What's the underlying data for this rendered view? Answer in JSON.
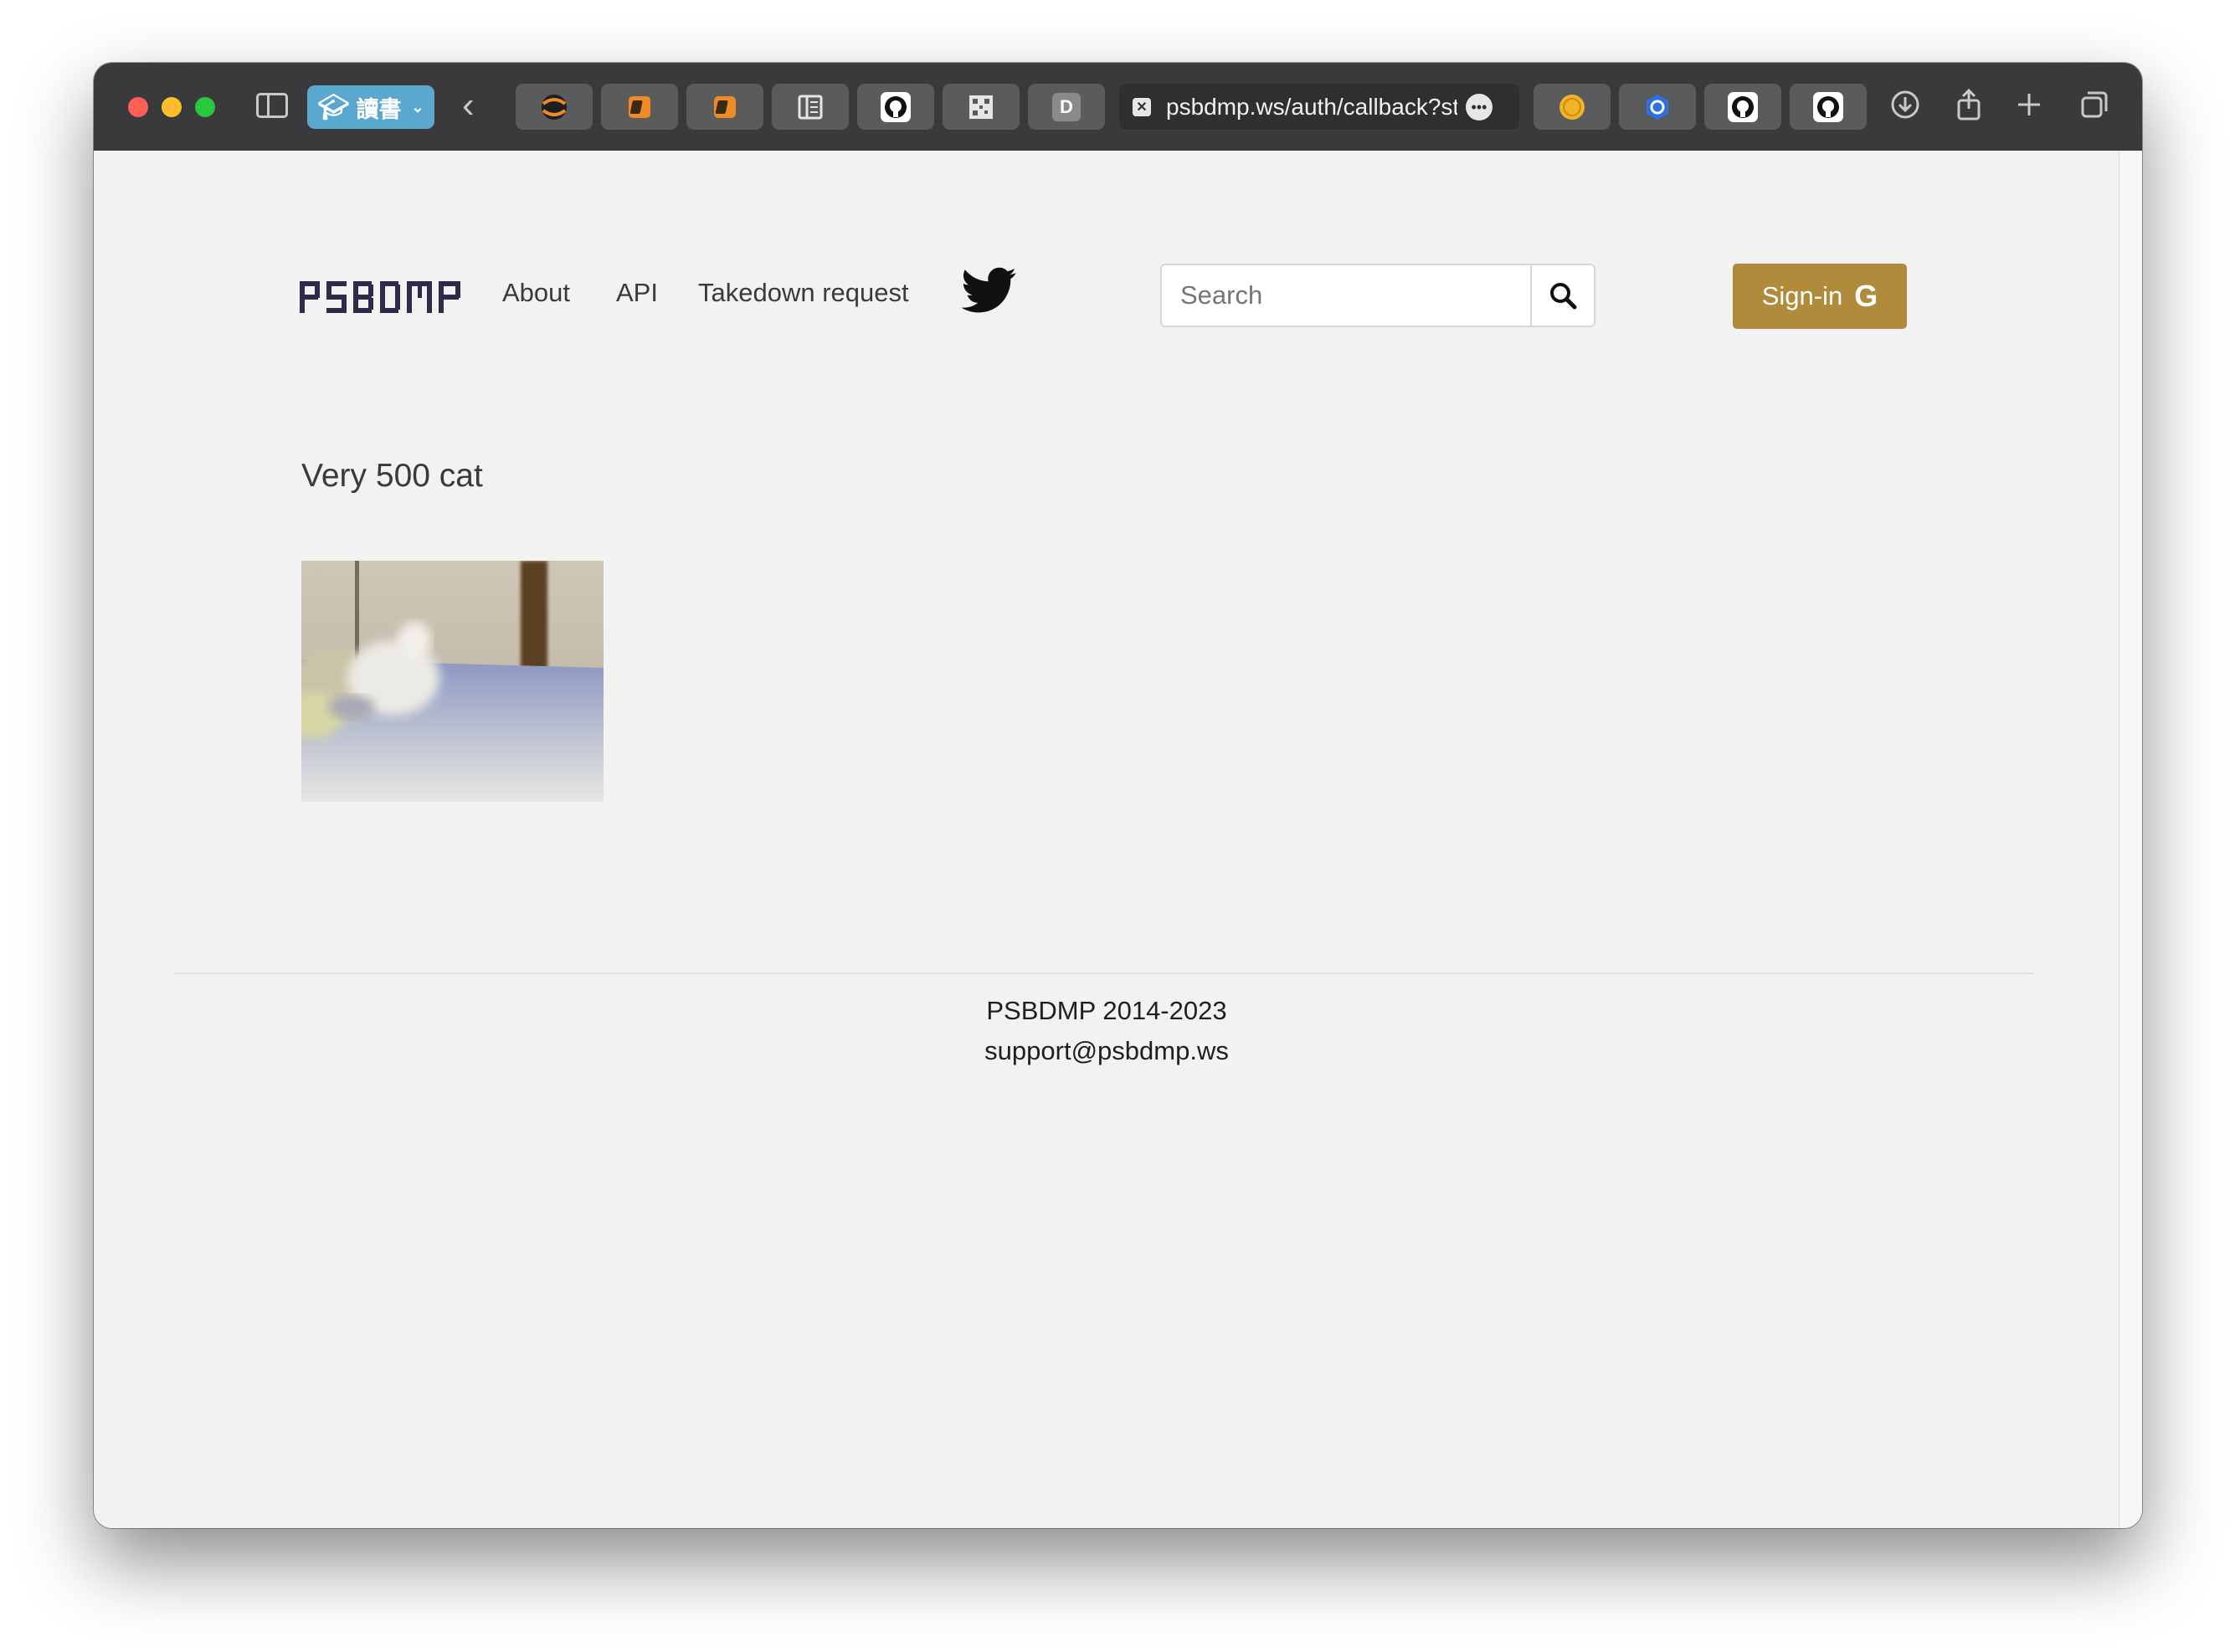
{
  "browser": {
    "tab_group_label": "讀書",
    "active_tab": {
      "url": "psbdmp.ws/auth/callback?st"
    },
    "pinned_tabs": [
      {
        "icon": "circle-orange-icon"
      },
      {
        "icon": "book-orange-icon"
      },
      {
        "icon": "book-orange-icon"
      },
      {
        "icon": "reader-icon"
      },
      {
        "icon": "github-icon"
      },
      {
        "icon": "qr-grid-icon"
      },
      {
        "icon": "letter-d-icon",
        "letter": "D"
      }
    ],
    "right_tabs": [
      {
        "icon": "bitcoin-icon"
      },
      {
        "icon": "blue-hex-icon"
      },
      {
        "icon": "github-icon"
      },
      {
        "icon": "github-icon"
      }
    ]
  },
  "site": {
    "logo_text": "PSBDMP",
    "nav": {
      "about": "About",
      "api": "API",
      "takedown": "Takedown request"
    },
    "search": {
      "placeholder": "Search"
    },
    "signin_label": "Sign-in",
    "signin_icon": "G"
  },
  "content": {
    "error_title": "Very 500 cat"
  },
  "footer": {
    "copyright": "PSBDMP 2014-2023",
    "email": "support@psbdmp.ws"
  },
  "colors": {
    "accent": "#b08b3c",
    "logo": "#2d2a4a",
    "background": "#f2f2f2"
  }
}
